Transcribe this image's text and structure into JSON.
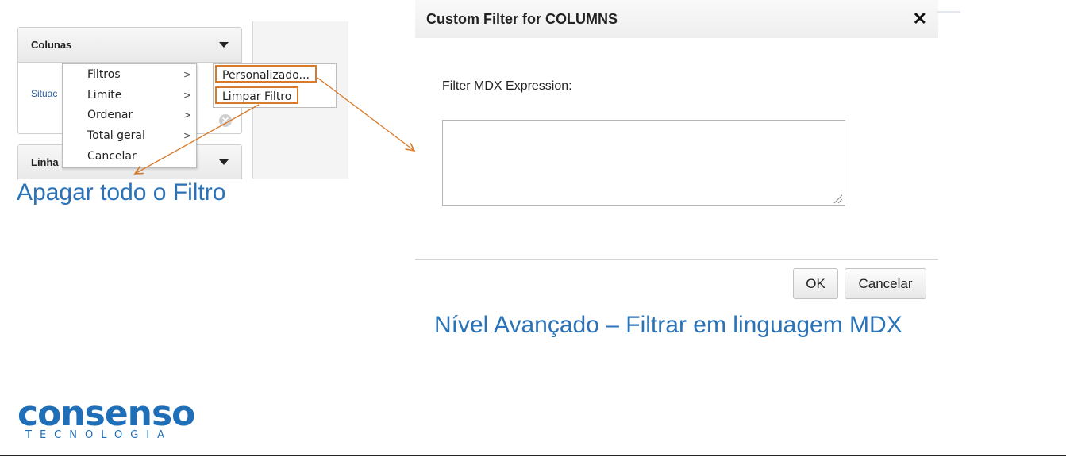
{
  "left_panel": {
    "colunas_title": "Colunas",
    "linhas_title": "Linha",
    "situac_text": "Situac",
    "clear_symbol": "✕",
    "context_menu": [
      {
        "label": "Filtros",
        "arrow": ">"
      },
      {
        "label": "Limite",
        "arrow": ">"
      },
      {
        "label": "Ordenar",
        "arrow": ">"
      },
      {
        "label": "Total geral",
        "arrow": ">"
      },
      {
        "label": "Cancelar",
        "arrow": ""
      }
    ],
    "submenu": [
      {
        "label": "Personalizado..."
      },
      {
        "label": "Limpar Filtro"
      }
    ]
  },
  "captions": {
    "left": "Apagar todo o Filtro",
    "right": "Nível Avançado – Filtrar em linguagem MDX"
  },
  "dialog": {
    "title": "Custom Filter for COLUMNS",
    "close_symbol": "✕",
    "field_label": "Filter MDX Expression:",
    "expression_value": "",
    "ok_label": "OK",
    "cancel_label": "Cancelar"
  },
  "logo": {
    "main": "consenso",
    "sub": "TECNOLOGIA"
  },
  "colors": {
    "accent_orange": "#d87a2a",
    "caption_blue": "#2a73b8",
    "logo_blue": "#1f6fb8"
  },
  "icons": [
    "caret-down-icon",
    "submenu-arrow-icon",
    "clear-icon",
    "close-icon",
    "resize-grip-icon"
  ]
}
